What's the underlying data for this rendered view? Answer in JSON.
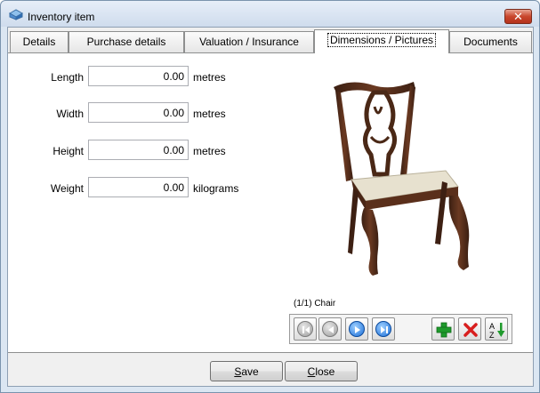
{
  "window": {
    "title": "Inventory item",
    "close_glyph": "✕"
  },
  "tabs": [
    {
      "label": "Details"
    },
    {
      "label": "Purchase details"
    },
    {
      "label": "Valuation / Insurance"
    },
    {
      "label": "Dimensions / Pictures",
      "active": true
    },
    {
      "label": "Documents"
    }
  ],
  "fields": {
    "length": {
      "label": "Length",
      "value": "0.00",
      "unit": "metres"
    },
    "width": {
      "label": "Width",
      "value": "0.00",
      "unit": "metres"
    },
    "height": {
      "label": "Height",
      "value": "0.00",
      "unit": "metres"
    },
    "weight": {
      "label": "Weight",
      "value": "0.00",
      "unit": "kilograms"
    }
  },
  "picture": {
    "caption": "(1/1) Chair",
    "nav_icons": [
      "first-icon",
      "previous-icon",
      "next-icon",
      "last-icon",
      "add-icon",
      "delete-icon",
      "sort-az-icon"
    ],
    "sort_glyph_a": "A",
    "sort_glyph_z": "Z"
  },
  "buttons": {
    "save_accel": "S",
    "save_rest": "ave",
    "close_accel": "C",
    "close_rest": "lose"
  }
}
